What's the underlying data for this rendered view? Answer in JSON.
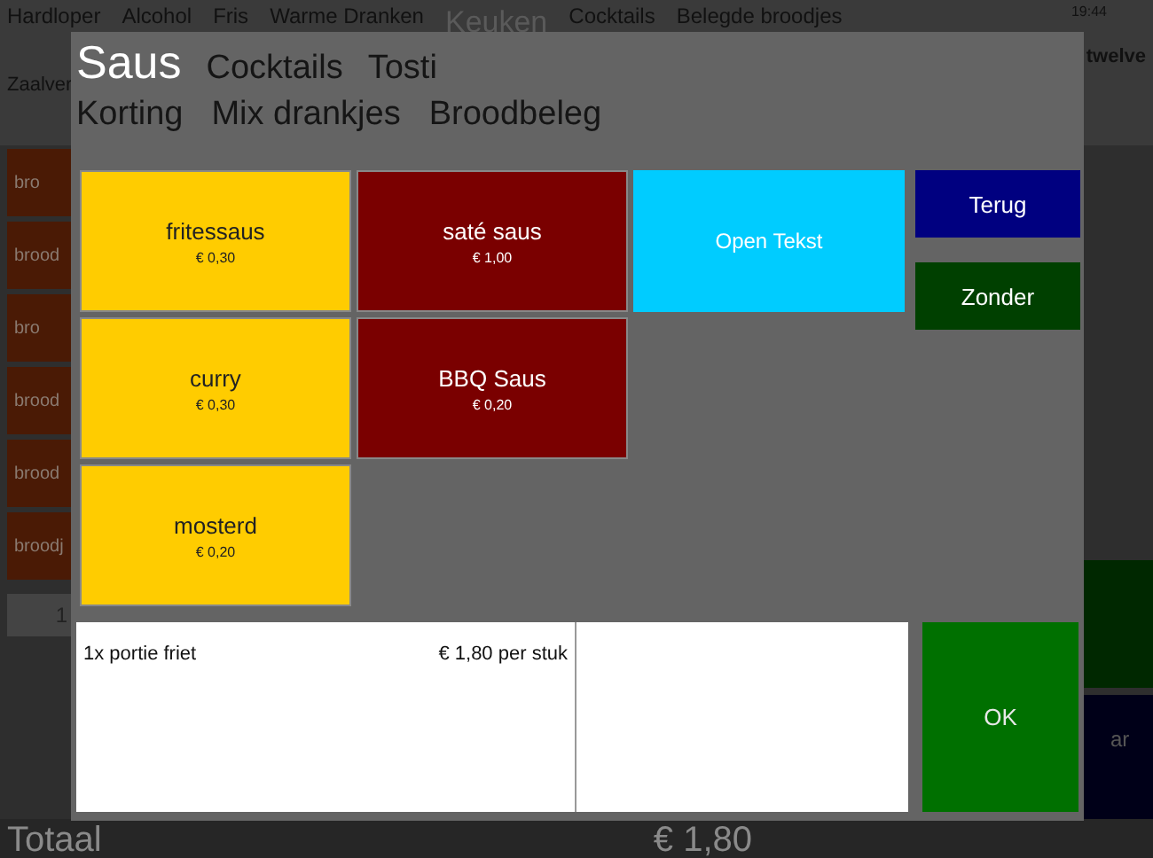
{
  "top_menu": [
    {
      "label": "Hardloper",
      "selected": false
    },
    {
      "label": "Alcohol",
      "selected": false
    },
    {
      "label": "Fris",
      "selected": false
    },
    {
      "label": "Warme Dranken",
      "selected": false
    },
    {
      "label": "Keuken",
      "selected": true
    },
    {
      "label": "Cocktails",
      "selected": false
    },
    {
      "label": "Belegde broodjes",
      "selected": false
    }
  ],
  "clock": "19:44",
  "logo": "twelve",
  "sub_menu": "Zaalver",
  "side_buttons": [
    "bro",
    "brood",
    "bro",
    "brood",
    "brood",
    "broodj"
  ],
  "order_row": {
    "quantity": "1"
  },
  "total": {
    "label": "Totaal",
    "amount": "€ 1,80"
  },
  "side_action": "ar",
  "dialog": {
    "categories": [
      [
        {
          "label": "Saus",
          "selected": true
        },
        {
          "label": "Cocktails",
          "selected": false
        },
        {
          "label": "Tosti",
          "selected": false
        }
      ],
      [
        {
          "label": "Korting",
          "selected": false
        },
        {
          "label": "Mix drankjes",
          "selected": false
        },
        {
          "label": "Broodbeleg",
          "selected": false
        }
      ]
    ],
    "products": [
      {
        "kind": "product",
        "name": "fritessaus",
        "price": "€ 0,30",
        "color": "#ffcc00"
      },
      {
        "kind": "product",
        "name": "curry",
        "price": "€ 0,30",
        "color": "#ffcc00"
      },
      {
        "kind": "product",
        "name": "mosterd",
        "price": "€ 0,20",
        "color": "#ffcc00"
      },
      {
        "kind": "product",
        "name": "saté saus",
        "price": "€ 1,00",
        "color": "#7a0000"
      },
      {
        "kind": "product",
        "name": "BBQ Saus",
        "price": "€ 0,20",
        "color": "#7a0000"
      },
      {
        "kind": "empty"
      },
      {
        "kind": "open_text",
        "name": "Open Tekst",
        "color": "#00ccff"
      }
    ],
    "actions": [
      {
        "label": "Terug",
        "color": "#000080"
      },
      {
        "label": "Zonder",
        "color": "#004000"
      }
    ],
    "line": {
      "description": "1x portie friet",
      "price": "€ 1,80 per stuk"
    },
    "ok": "OK"
  }
}
